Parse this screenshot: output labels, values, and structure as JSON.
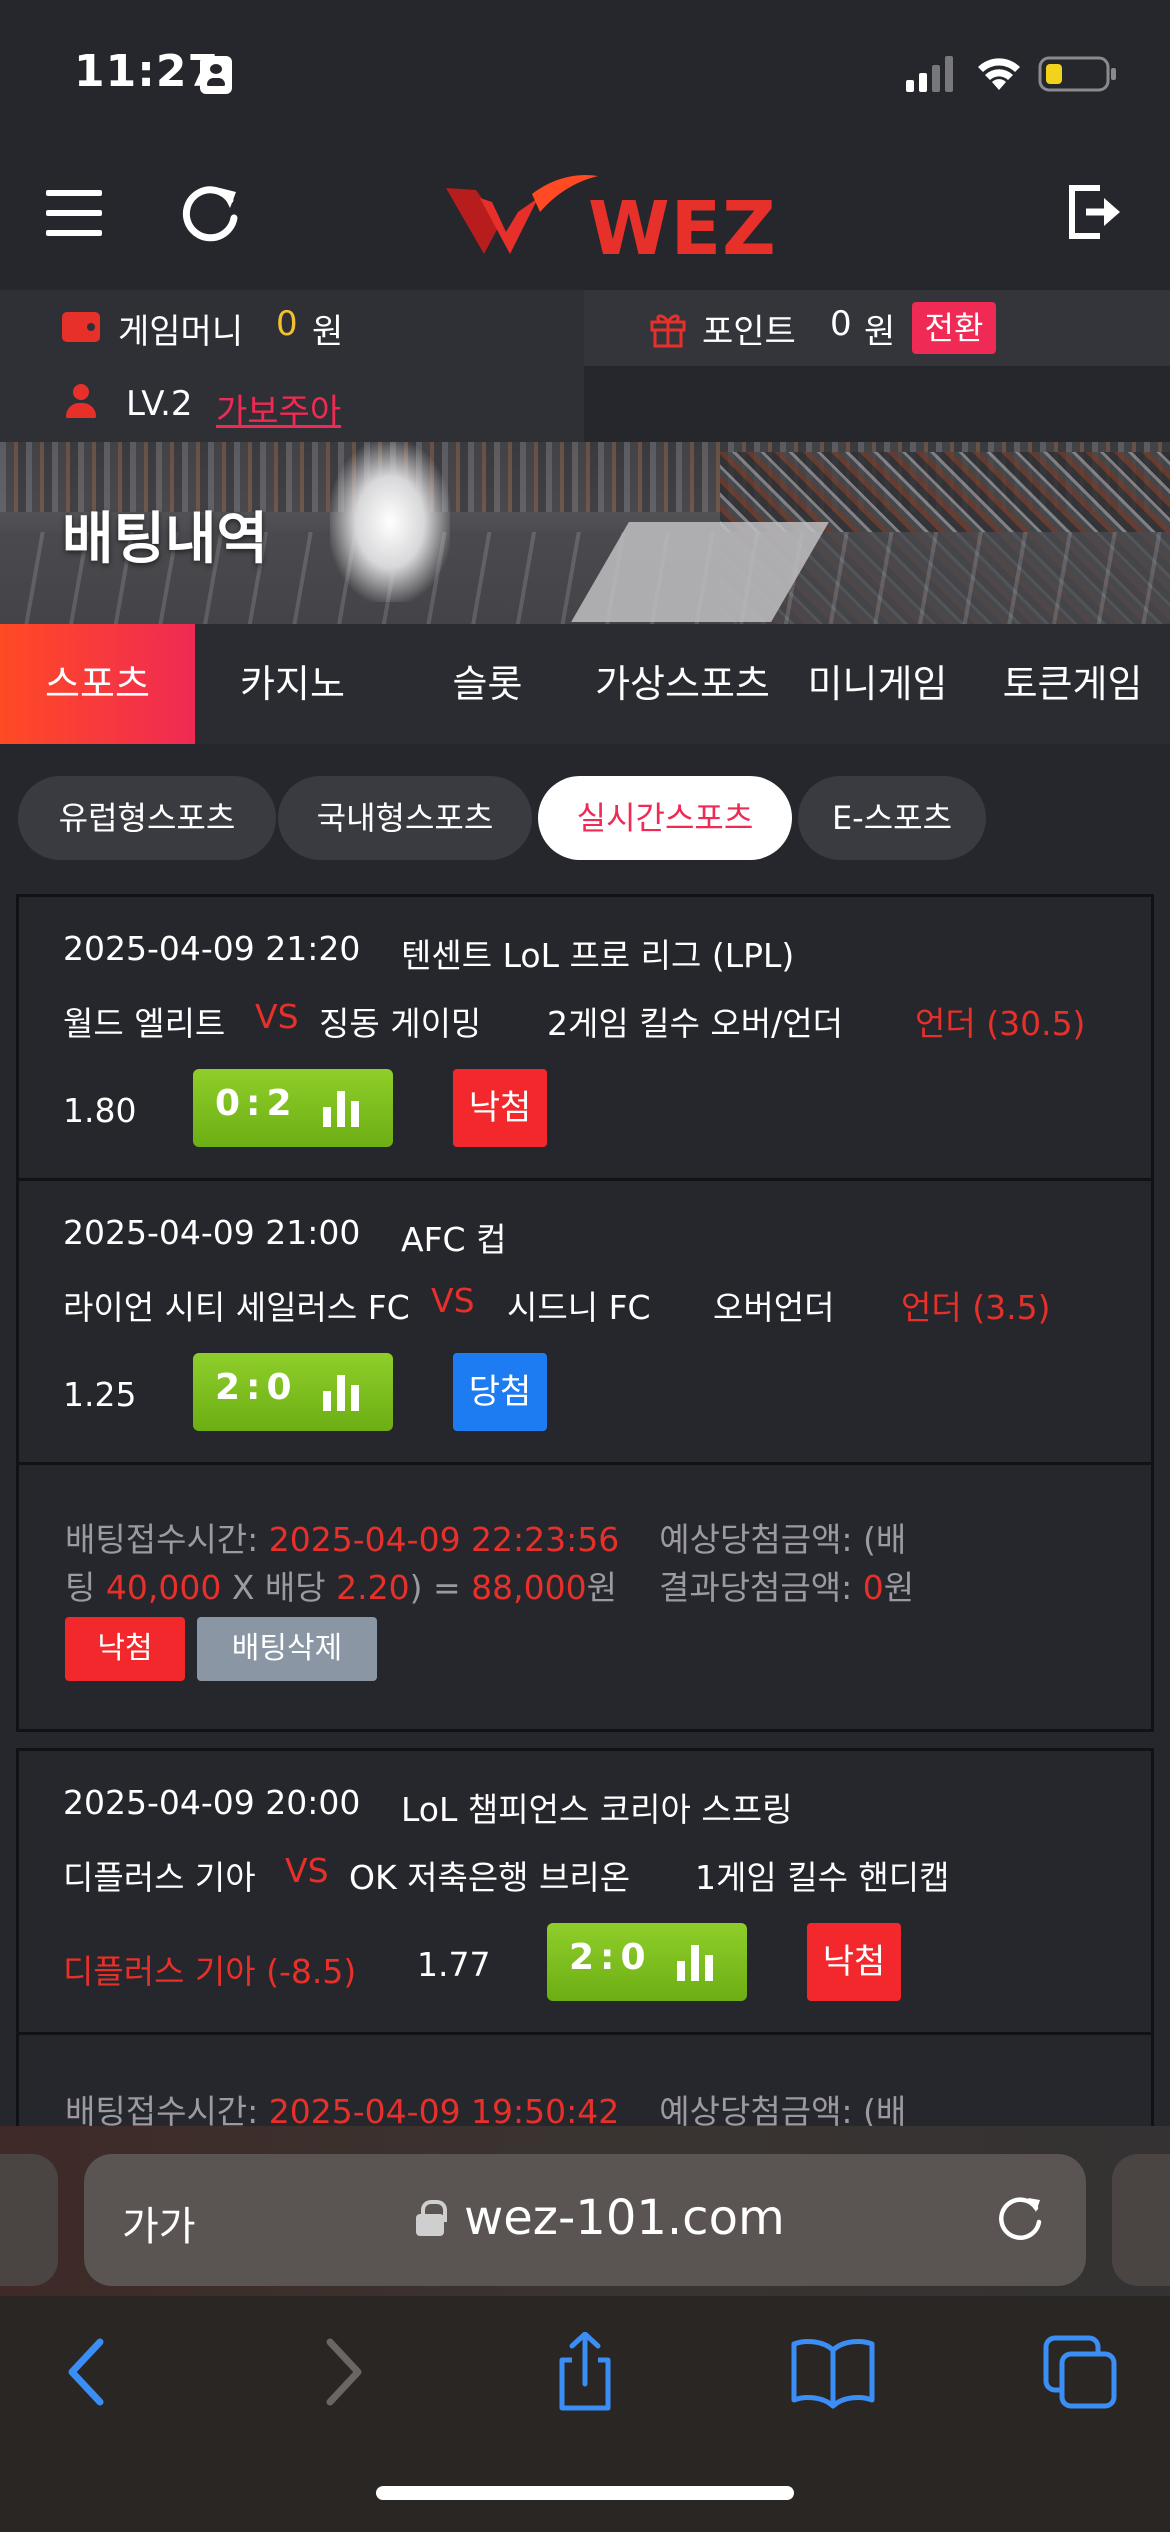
{
  "status_bar": {
    "time": "11:27"
  },
  "header": {
    "logo_text": "WEZ"
  },
  "account": {
    "game_money_label": "게임머니",
    "game_money_value": "0",
    "game_money_unit": "원",
    "point_label": "포인트",
    "point_value": "0",
    "point_unit": "원",
    "convert_label": "전환",
    "level": "LV.2",
    "nickname": "가보주아"
  },
  "banner": {
    "title": "배팅내역"
  },
  "category_tabs": [
    "스포츠",
    "카지노",
    "슬롯",
    "가상스포츠",
    "미니게임",
    "토큰게임"
  ],
  "sub_tabs": [
    "유럽형스포츠",
    "국내형스포츠",
    "실시간스포츠",
    "E-스포츠"
  ],
  "bets": [
    {
      "datetime": "2025-04-09 21:20",
      "league": "텐센트 LoL 프로 리그 (LPL)",
      "home": "월드 엘리트",
      "vs": "VS",
      "away": "징동 게이밍",
      "market": "2게임 킬수 오버/언더",
      "pick": "언더 (30.5)",
      "odds": "1.80",
      "score": "0:2",
      "result": "낙첨"
    },
    {
      "datetime": "2025-04-09 21:00",
      "league": "AFC 컵",
      "home": "라이언 시티 세일러스 FC",
      "vs": "VS",
      "away": "시드니 FC",
      "market": "오버언더",
      "pick": "언더 (3.5)",
      "odds": "1.25",
      "score": "2:0",
      "result": "당첨"
    }
  ],
  "summary1": {
    "time_label": "배팅접수시간: ",
    "time_value": "2025-04-09 22:23:56",
    "expected_label": "예상당첨금액: (배",
    "line2_prefix": "팅 ",
    "stake": "40,000",
    "x_label": " X 배당 ",
    "odds": "2.20",
    "eq_label": ") = ",
    "expected": "88,000",
    "won": "원",
    "result_label": "결과당첨금액: ",
    "result_value": "0",
    "result_unit": "원",
    "status": "낙첨",
    "delete_label": "배팅삭제"
  },
  "bet3": {
    "datetime": "2025-04-09 20:00",
    "league": "LoL 챔피언스 코리아 스프링",
    "home": "디플러스 기아",
    "vs": "VS",
    "away": "OK 저축은행 브리온",
    "market": "1게임 킬수 핸디캡",
    "pick": "디플러스 기아 (-8.5)",
    "odds": "1.77",
    "score": "2:0",
    "result": "낙첨"
  },
  "summary2": {
    "time_label": "배팅접수시간: ",
    "time_value": "2025-04-09 19:50:42",
    "expected_label": "예상당첨금액: (배"
  },
  "browser": {
    "aa_label": "가가",
    "url": "wez-101.com"
  },
  "colors": {
    "accent_red": "#e8302a",
    "accent_pink": "#ef2a54",
    "win_blue": "#1e7cf2",
    "score_green": "#7bbf1f",
    "background": "#26272c"
  }
}
